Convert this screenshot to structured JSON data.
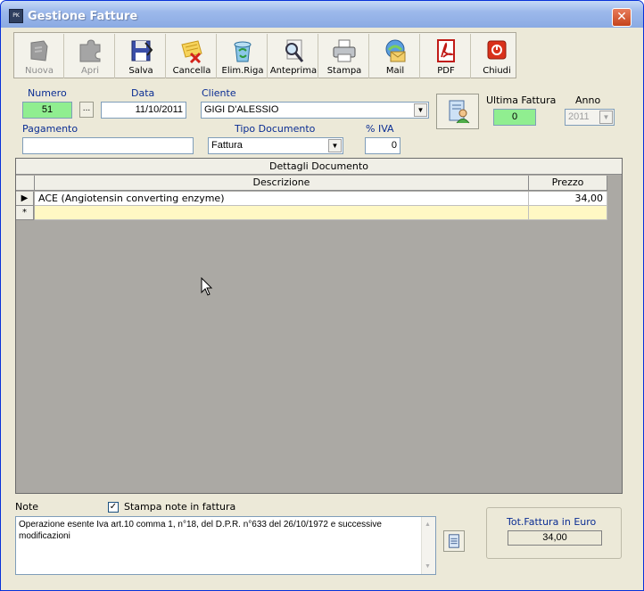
{
  "window": {
    "title": "Gestione Fatture",
    "app_icon": "PK"
  },
  "toolbar": {
    "buttons": [
      {
        "label": "Nuova",
        "icon": "new-document-icon",
        "enabled": false
      },
      {
        "label": "Apri",
        "icon": "open-puzzle-icon",
        "enabled": false
      },
      {
        "label": "Salva",
        "icon": "save-disk-icon",
        "enabled": true
      },
      {
        "label": "Cancella",
        "icon": "delete-note-icon",
        "enabled": true
      },
      {
        "label": "Elim.Riga",
        "icon": "recycle-bin-icon",
        "enabled": true
      },
      {
        "label": "Anteprima",
        "icon": "magnifier-preview-icon",
        "enabled": true
      },
      {
        "label": "Stampa",
        "icon": "printer-icon",
        "enabled": true
      },
      {
        "label": "Mail",
        "icon": "mail-icon",
        "enabled": true
      },
      {
        "label": "PDF",
        "icon": "pdf-icon",
        "enabled": true
      },
      {
        "label": "Chiudi",
        "icon": "power-close-icon",
        "enabled": true
      }
    ]
  },
  "form": {
    "numero_label": "Numero",
    "numero_value": "51",
    "numero_button": "...",
    "data_label": "Data",
    "data_value": "11/10/2011",
    "cliente_label": "Cliente",
    "cliente_value": "GIGI D'ALESSIO",
    "ultima_fattura_label": "Ultima Fattura",
    "ultima_fattura_value": "0",
    "anno_label": "Anno",
    "anno_value": "2011",
    "pagamento_label": "Pagamento",
    "pagamento_value": "",
    "tipo_documento_label": "Tipo Documento",
    "tipo_documento_value": "Fattura",
    "iva_label": "% IVA",
    "iva_value": "0"
  },
  "grid": {
    "title": "Dettagli Documento",
    "columns": [
      "Descrizione",
      "Prezzo"
    ],
    "rows": [
      {
        "descrizione": "ACE (Angiotensin converting enzyme)",
        "prezzo": "34,00"
      }
    ],
    "new_row_marker": "*"
  },
  "notes": {
    "label": "Note",
    "print_checkbox_label": "Stampa note in fattura",
    "print_checked": true,
    "text": "Operazione esente Iva art.10 comma 1, n°18, del D.P.R. n°633 del 26/10/1972 e successive modificazioni"
  },
  "totals": {
    "label": "Tot.Fattura in Euro",
    "value": "34,00"
  },
  "colors": {
    "accent_label": "#0a2d93",
    "highlight_green": "#90ee90",
    "new_row_yellow": "#fff8c4",
    "grid_background": "#aba9a4"
  }
}
